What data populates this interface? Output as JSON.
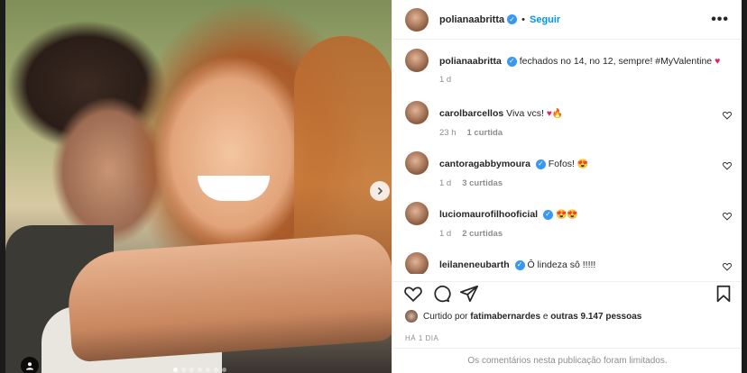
{
  "post": {
    "author": "polianaabritta",
    "follow_label": "Seguir",
    "separator": "•",
    "more_label": "•••",
    "caption": {
      "username": "polianaabritta",
      "text": "fechados no 14, no 12, sempre! #MyValentine",
      "emoji": "♥",
      "time": "1 d"
    }
  },
  "comments": [
    {
      "username": "carolbarcellos",
      "verified": false,
      "text": "Viva vcs!",
      "emoji": "♥🔥",
      "time": "23 h",
      "likes": "1 curtida"
    },
    {
      "username": "cantoragabbymoura",
      "verified": true,
      "text": "Fofos!",
      "emoji": "😍",
      "time": "1 d",
      "likes": "3 curtidas"
    },
    {
      "username": "luciomaurofilhooficial",
      "verified": true,
      "text": "",
      "emoji": "😍😍",
      "time": "1 d",
      "likes": "2 curtidas"
    },
    {
      "username": "leilaneneubarth",
      "verified": true,
      "text": "Ô lindeza sô !!!!!",
      "emoji": "",
      "time": "",
      "likes": ""
    }
  ],
  "likes_line": {
    "prefix": "Curtido por",
    "user": "fatimabernardes",
    "middle": "e",
    "rest": "outras 9.147 pessoas"
  },
  "date_label": "HÁ 1 DIA",
  "comments_limited": "Os comentários nesta publicação foram limitados.",
  "icons": {
    "like": "heart-icon",
    "comment": "comment-icon",
    "share": "paper-plane-icon",
    "save": "bookmark-icon",
    "next": "chevron-right-icon",
    "tag": "user-tag-icon"
  },
  "colors": {
    "link": "#0095f6",
    "verified": "#3897f0",
    "heart": "#e0245e"
  },
  "carousel": {
    "slides": 7,
    "active_index": 0
  }
}
